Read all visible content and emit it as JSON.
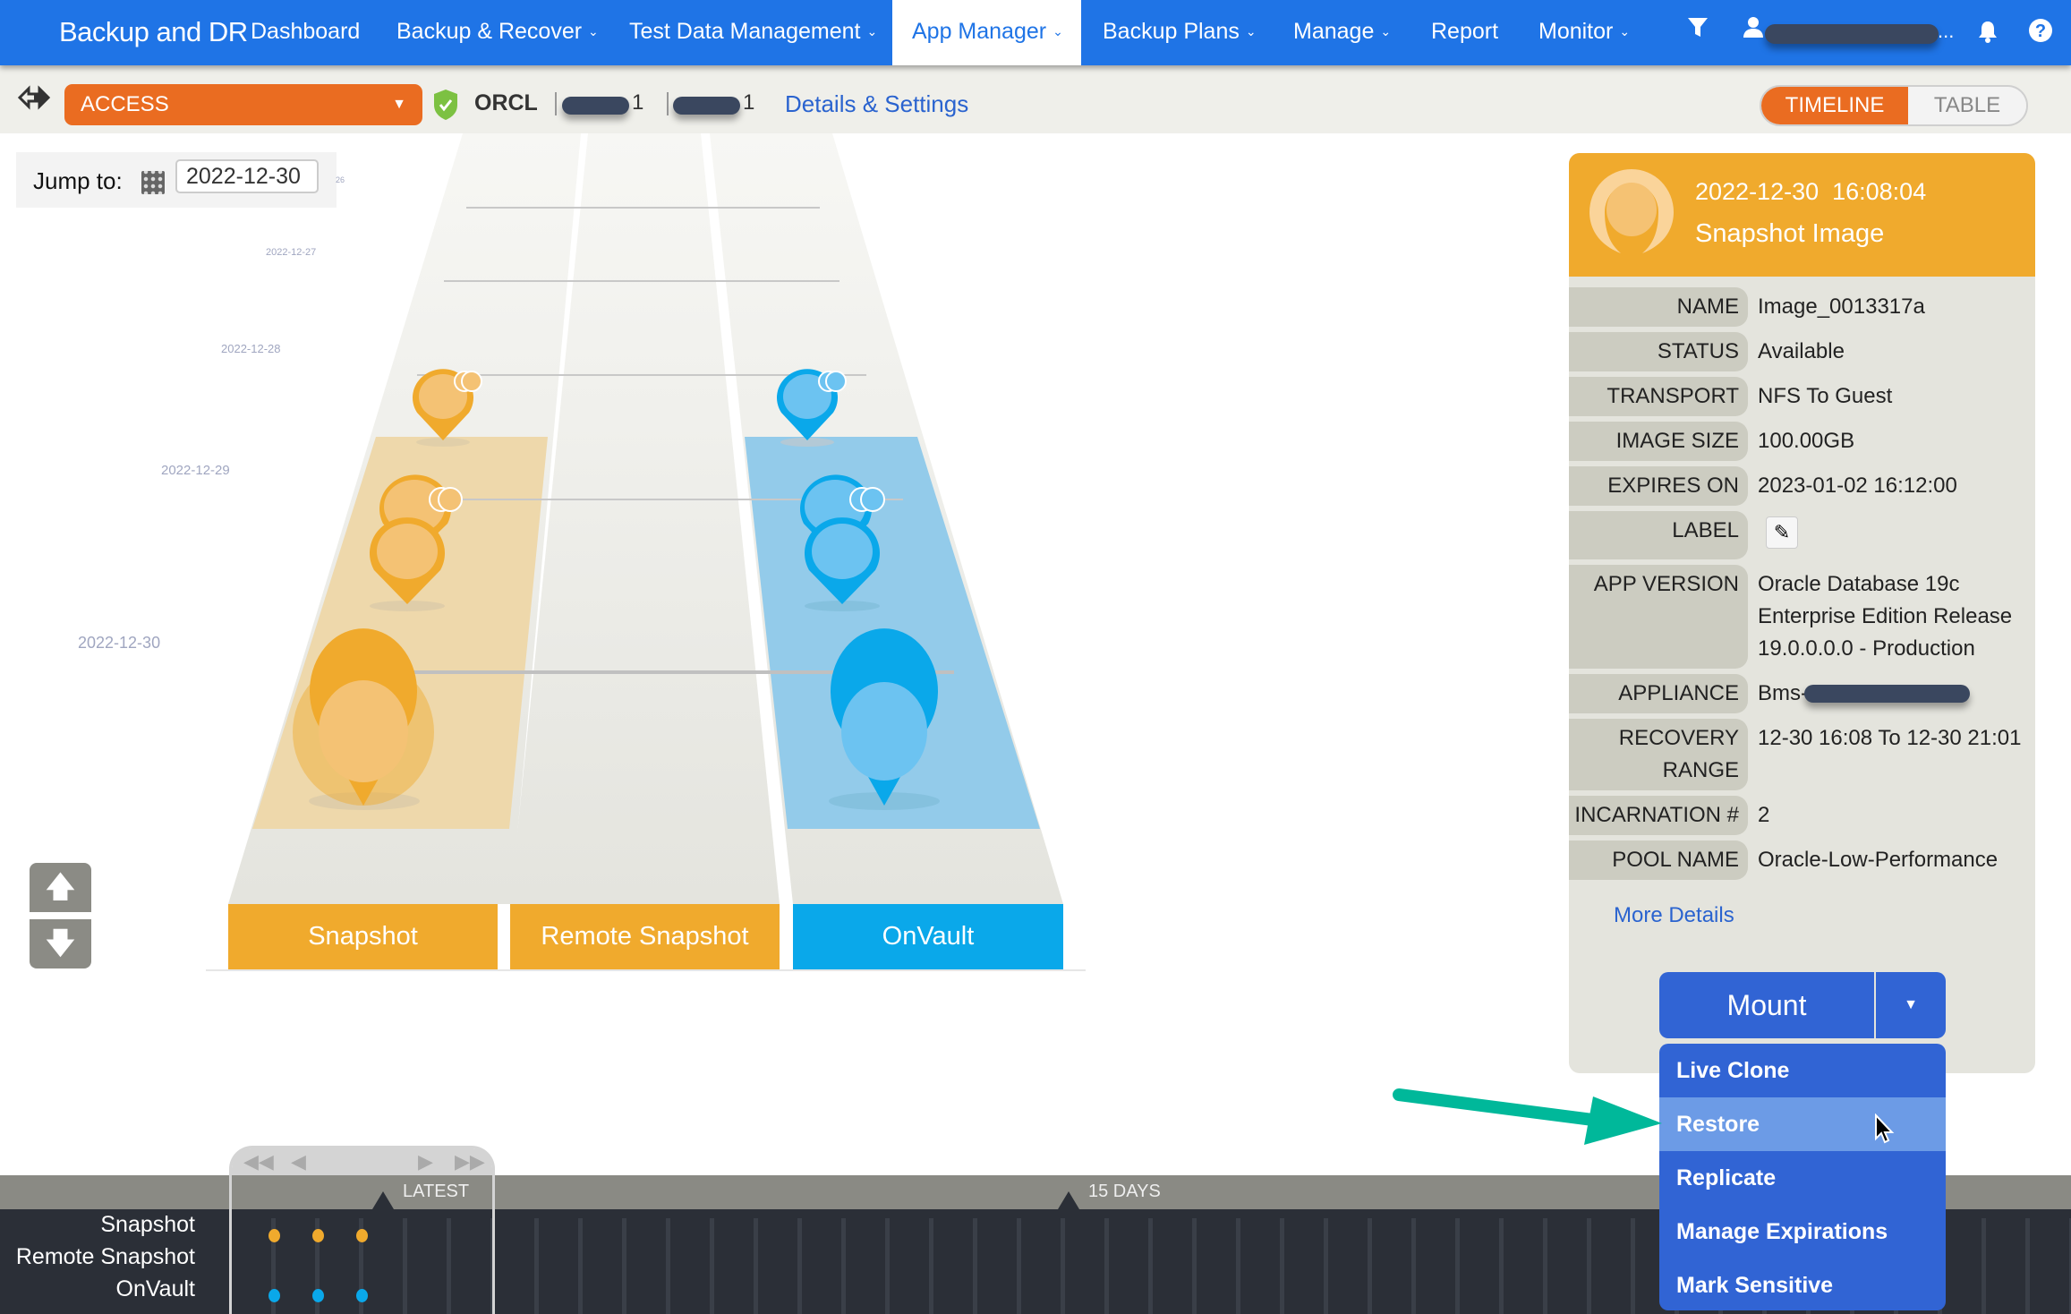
{
  "nav": {
    "brand": "Backup and DR",
    "items": [
      {
        "label": "Dashboard",
        "dropdown": false
      },
      {
        "label": "Backup & Recover",
        "dropdown": true
      },
      {
        "label": "Test Data Management",
        "dropdown": true
      },
      {
        "label": "App Manager",
        "dropdown": true,
        "active": true
      },
      {
        "label": "Backup Plans",
        "dropdown": true
      },
      {
        "label": "Manage",
        "dropdown": true
      },
      {
        "label": "Report",
        "dropdown": false
      },
      {
        "label": "Monitor",
        "dropdown": true
      }
    ],
    "icons": [
      "filter-icon",
      "user-icon",
      "bell-icon",
      "help-icon"
    ],
    "user_ellipsis": "..."
  },
  "subbar": {
    "app_select": "ACCESS",
    "app_name": "ORCL",
    "host_suffix_1": "1",
    "host_suffix_2": "1",
    "details_link": "Details & Settings",
    "view_toggle": {
      "timeline": "TIMELINE",
      "table": "TABLE",
      "selected": "TIMELINE"
    }
  },
  "jump_to": {
    "label": "Jump to:",
    "value": "2022-12-30"
  },
  "timeline_dates": [
    "26",
    "2022-12-27",
    "2022-12-28",
    "2022-12-29",
    "2022-12-30"
  ],
  "columns": [
    {
      "label": "Snapshot",
      "color": "#f0aa2d"
    },
    {
      "label": "Remote Snapshot",
      "color": "#f0aa2d"
    },
    {
      "label": "OnVault",
      "color": "#0aa8ea"
    }
  ],
  "details": {
    "timestamp": "2022-12-30  16:08:04",
    "type": "Snapshot Image",
    "rows": [
      {
        "key": "NAME",
        "value": "Image_0013317a"
      },
      {
        "key": "STATUS",
        "value": "Available"
      },
      {
        "key": "TRANSPORT",
        "value": "NFS To Guest"
      },
      {
        "key": "IMAGE SIZE",
        "value": "100.00GB"
      },
      {
        "key": "EXPIRES ON",
        "value": "2023-01-02 16:12:00"
      },
      {
        "key": "LABEL",
        "value": ""
      },
      {
        "key": "APP VERSION",
        "value": "Oracle Database 19c\nEnterprise Edition Release\n19.0.0.0.0 - Production"
      },
      {
        "key": "APPLIANCE",
        "value": "Bms-"
      },
      {
        "key": "RECOVERY\nRANGE",
        "value": "12-30 16:08 To 12-30 21:01"
      },
      {
        "key": "INCARNATION #",
        "value": "2"
      },
      {
        "key": "POOL NAME",
        "value": "Oracle-Low-Performance"
      }
    ],
    "more_details": "More Details"
  },
  "mount": {
    "label": "Mount",
    "menu": [
      "Live Clone",
      "Restore",
      "Replicate",
      "Manage Expirations",
      "Mark Sensitive"
    ],
    "highlighted": "Restore"
  },
  "bottom_timeline": {
    "rows": [
      "Snapshot",
      "Remote Snapshot",
      "OnVault"
    ],
    "markers": [
      "LATEST",
      "15 DAYS"
    ],
    "snapshot_dots": 3,
    "onvault_dots": 3,
    "colors": {
      "snapshot": "#f0aa2d",
      "onvault": "#0aa8ea"
    }
  }
}
